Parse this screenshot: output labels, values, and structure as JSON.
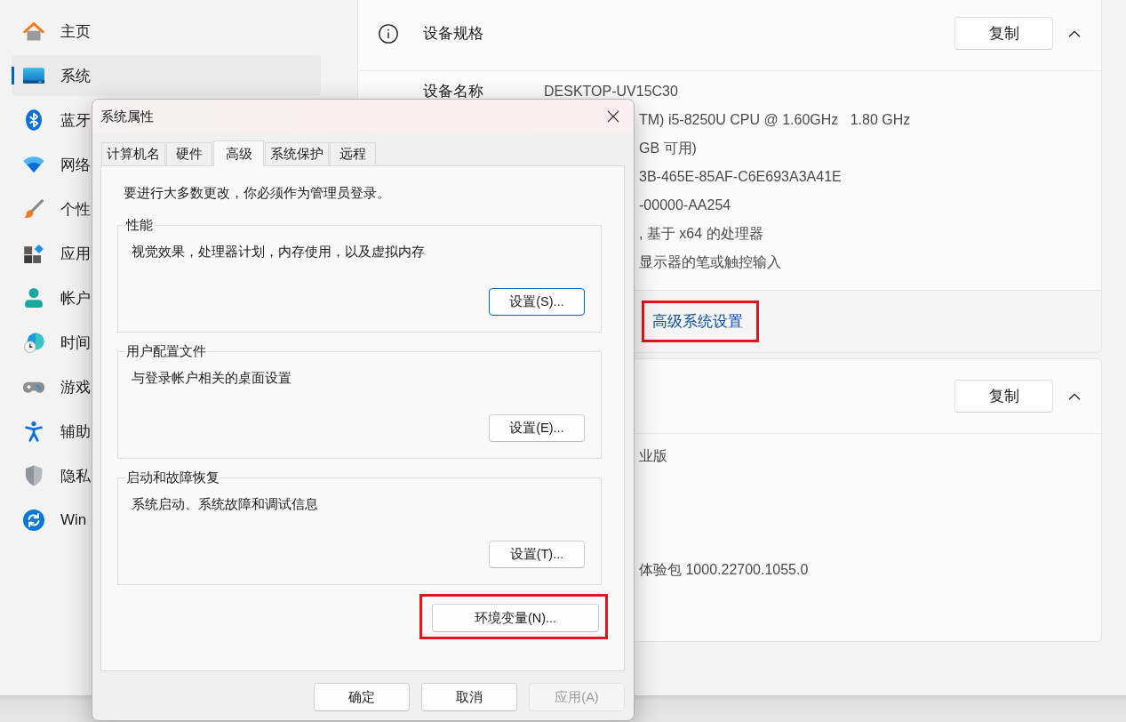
{
  "settings": {
    "sidebar": [
      {
        "label": "主页",
        "selected": false
      },
      {
        "label": "系统",
        "selected": true
      },
      {
        "label": "蓝牙",
        "selected": false
      },
      {
        "label": "网络",
        "selected": false
      },
      {
        "label": "个性",
        "selected": false
      },
      {
        "label": "应用",
        "selected": false
      },
      {
        "label": "帐户",
        "selected": false
      },
      {
        "label": "时间",
        "selected": false
      },
      {
        "label": "游戏",
        "selected": false
      },
      {
        "label": "辅助",
        "selected": false
      },
      {
        "label": "隐私",
        "selected": false
      },
      {
        "label": "Win",
        "selected": false
      }
    ],
    "sections": [
      {
        "title": "设备规格",
        "copy_button": "复制",
        "expanded": true,
        "rows": [
          {
            "label": "设备名称",
            "value": "DESKTOP-UV15C30"
          },
          {
            "value": "TM) i5-8250U CPU @ 1.60GHz   1.80 GHz"
          },
          {
            "value": "GB 可用)"
          },
          {
            "value": "3B-465E-85AF-C6E693A3A41E"
          },
          {
            "value": "-00000-AA254"
          },
          {
            "value": ", 基于 x64 的处理器"
          },
          {
            "value": "显示器的笔或触控输入"
          }
        ],
        "link": {
          "label": "高级系统设置",
          "highlighted": true
        }
      },
      {
        "copy_button": "复制",
        "expanded": true,
        "rows": [
          {
            "value": "业版"
          },
          {
            "value": "体验包 1000.22700.1055.0"
          }
        ]
      }
    ]
  },
  "dialog": {
    "title": "系统属性",
    "tabs": [
      {
        "label": "计算机名",
        "selected": false
      },
      {
        "label": "硬件",
        "selected": false
      },
      {
        "label": "高级",
        "selected": true
      },
      {
        "label": "系统保护",
        "selected": false
      },
      {
        "label": "远程",
        "selected": false
      }
    ],
    "notice": "要进行大多数更改，你必须作为管理员登录。",
    "groups": [
      {
        "title": "性能",
        "description": "视觉效果，处理器计划，内存使用，以及虚拟内存",
        "button": {
          "label": "设置(S)...",
          "focused": true
        }
      },
      {
        "title": "用户配置文件",
        "description": "与登录帐户相关的桌面设置",
        "button": {
          "label": "设置(E)...",
          "focused": false
        }
      },
      {
        "title": "启动和故障恢复",
        "description": "系统启动、系统故障和调试信息",
        "button": {
          "label": "设置(T)...",
          "focused": false
        }
      }
    ],
    "env_button": {
      "label": "环境变量(N)...",
      "highlighted": true
    },
    "buttons": [
      {
        "label": "确定",
        "disabled": false
      },
      {
        "label": "取消",
        "disabled": false
      },
      {
        "label": "应用(A)",
        "disabled": true
      }
    ]
  }
}
